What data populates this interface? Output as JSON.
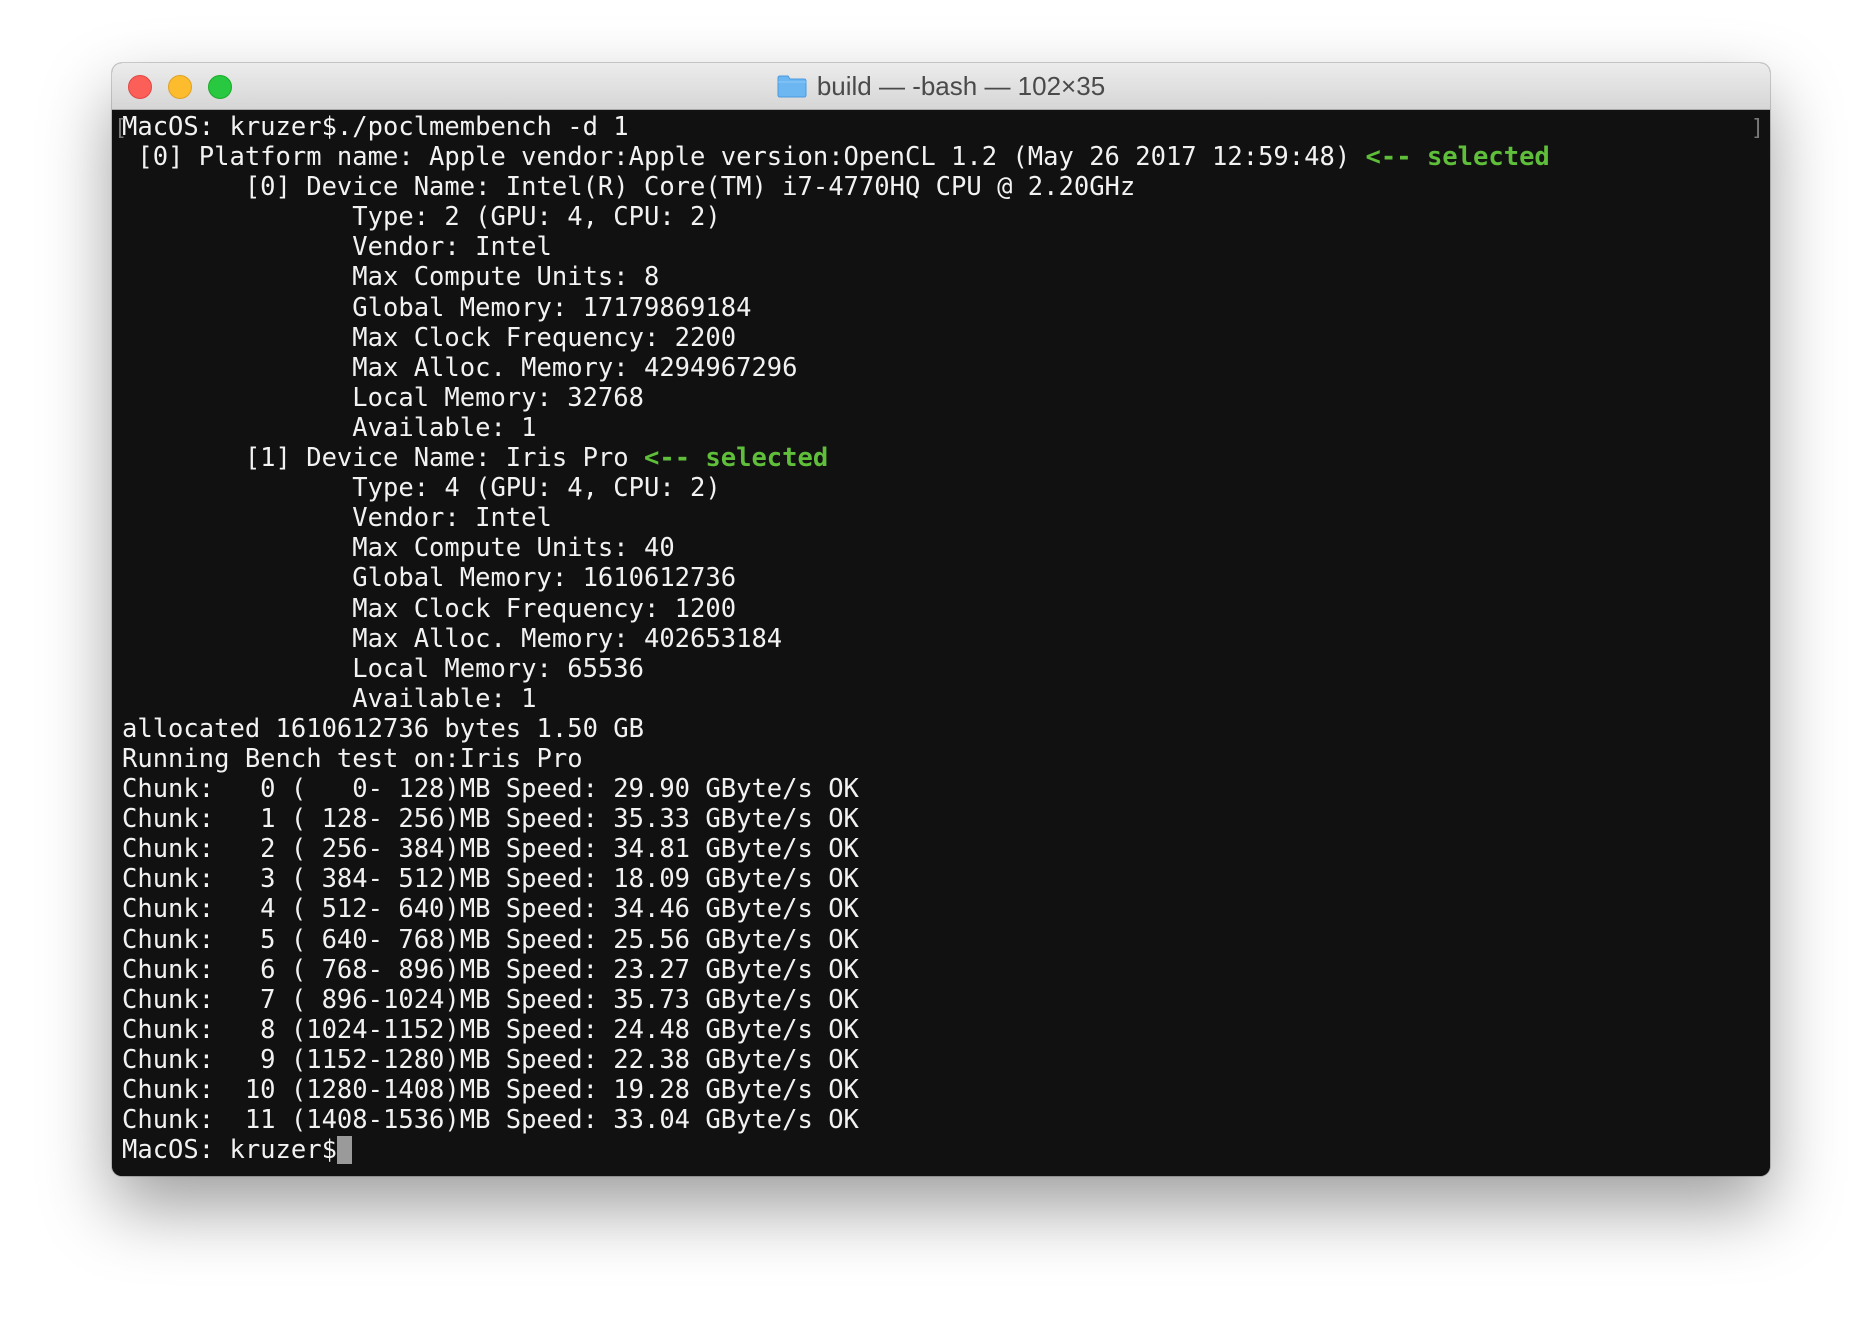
{
  "window": {
    "title": "build — -bash — 102×35"
  },
  "terminal": {
    "prompt_command": "MacOS: kruzer$./poclmembench -d 1",
    "platform_line": " [0] Platform name: Apple vendor:Apple version:OpenCL 1.2 (May 26 2017 12:59:48) ",
    "selected_marker": "<-- selected",
    "device0": {
      "header": "        [0] Device Name: Intel(R) Core(TM) i7-4770HQ CPU @ 2.20GHz",
      "lines": [
        "               Type: 2 (GPU: 4, CPU: 2)",
        "               Vendor: Intel",
        "               Max Compute Units: 8",
        "               Global Memory: 17179869184",
        "               Max Clock Frequency: 2200",
        "               Max Alloc. Memory: 4294967296",
        "               Local Memory: 32768",
        "               Available: 1"
      ]
    },
    "device1": {
      "header": "        [1] Device Name: Iris Pro ",
      "lines": [
        "               Type: 4 (GPU: 4, CPU: 2)",
        "               Vendor: Intel",
        "               Max Compute Units: 40",
        "               Global Memory: 1610612736",
        "               Max Clock Frequency: 1200",
        "               Max Alloc. Memory: 402653184",
        "               Local Memory: 65536",
        "               Available: 1"
      ]
    },
    "summary": [
      "allocated 1610612736 bytes 1.50 GB",
      "Running Bench test on:Iris Pro"
    ],
    "chunks": [
      "Chunk:   0 (   0- 128)MB Speed: 29.90 GByte/s OK",
      "Chunk:   1 ( 128- 256)MB Speed: 35.33 GByte/s OK",
      "Chunk:   2 ( 256- 384)MB Speed: 34.81 GByte/s OK",
      "Chunk:   3 ( 384- 512)MB Speed: 18.09 GByte/s OK",
      "Chunk:   4 ( 512- 640)MB Speed: 34.46 GByte/s OK",
      "Chunk:   5 ( 640- 768)MB Speed: 25.56 GByte/s OK",
      "Chunk:   6 ( 768- 896)MB Speed: 23.27 GByte/s OK",
      "Chunk:   7 ( 896-1024)MB Speed: 35.73 GByte/s OK",
      "Chunk:   8 (1024-1152)MB Speed: 24.48 GByte/s OK",
      "Chunk:   9 (1152-1280)MB Speed: 22.38 GByte/s OK",
      "Chunk:  10 (1280-1408)MB Speed: 19.28 GByte/s OK",
      "Chunk:  11 (1408-1536)MB Speed: 33.04 GByte/s OK"
    ],
    "final_prompt": "MacOS: kruzer$"
  },
  "colors": {
    "selected": "#5fbe3a",
    "background": "#111111",
    "text": "#f2f2f2"
  }
}
